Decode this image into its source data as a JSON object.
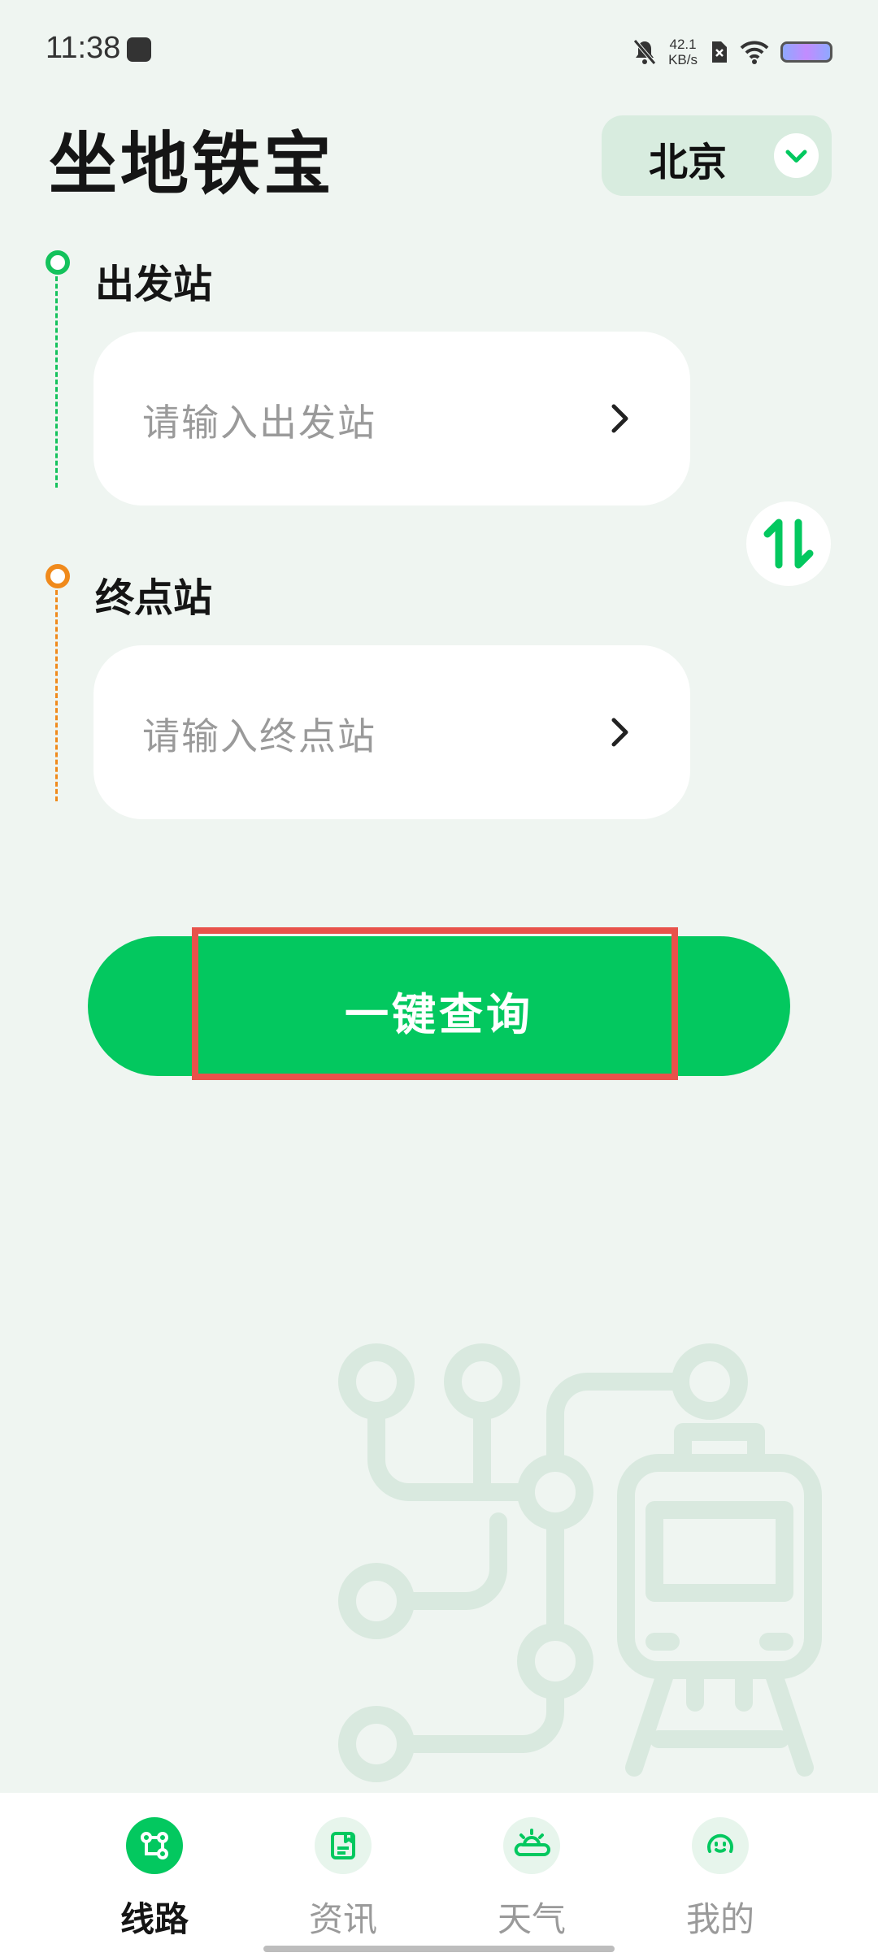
{
  "status_bar": {
    "time": "11:38",
    "net_speed_value": "42.1",
    "net_speed_unit": "KB/s"
  },
  "header": {
    "title": "坐地铁宝",
    "city": "北京"
  },
  "form": {
    "from_label": "出发站",
    "from_placeholder": "请输入出发站",
    "to_label": "终点站",
    "to_placeholder": "请输入终点站",
    "query_button": "一键查询"
  },
  "bottom_nav": {
    "items": [
      {
        "label": "线路",
        "icon": "route-icon",
        "active": true
      },
      {
        "label": "资讯",
        "icon": "news-icon",
        "active": false
      },
      {
        "label": "天气",
        "icon": "weather-icon",
        "active": false
      },
      {
        "label": "我的",
        "icon": "profile-icon",
        "active": false
      }
    ]
  },
  "colors": {
    "accent_green": "#03c85f",
    "origin_green": "#14c25c",
    "destination_orange": "#f08a1c",
    "highlight_red": "#e8524b",
    "background": "#eff5f1"
  }
}
